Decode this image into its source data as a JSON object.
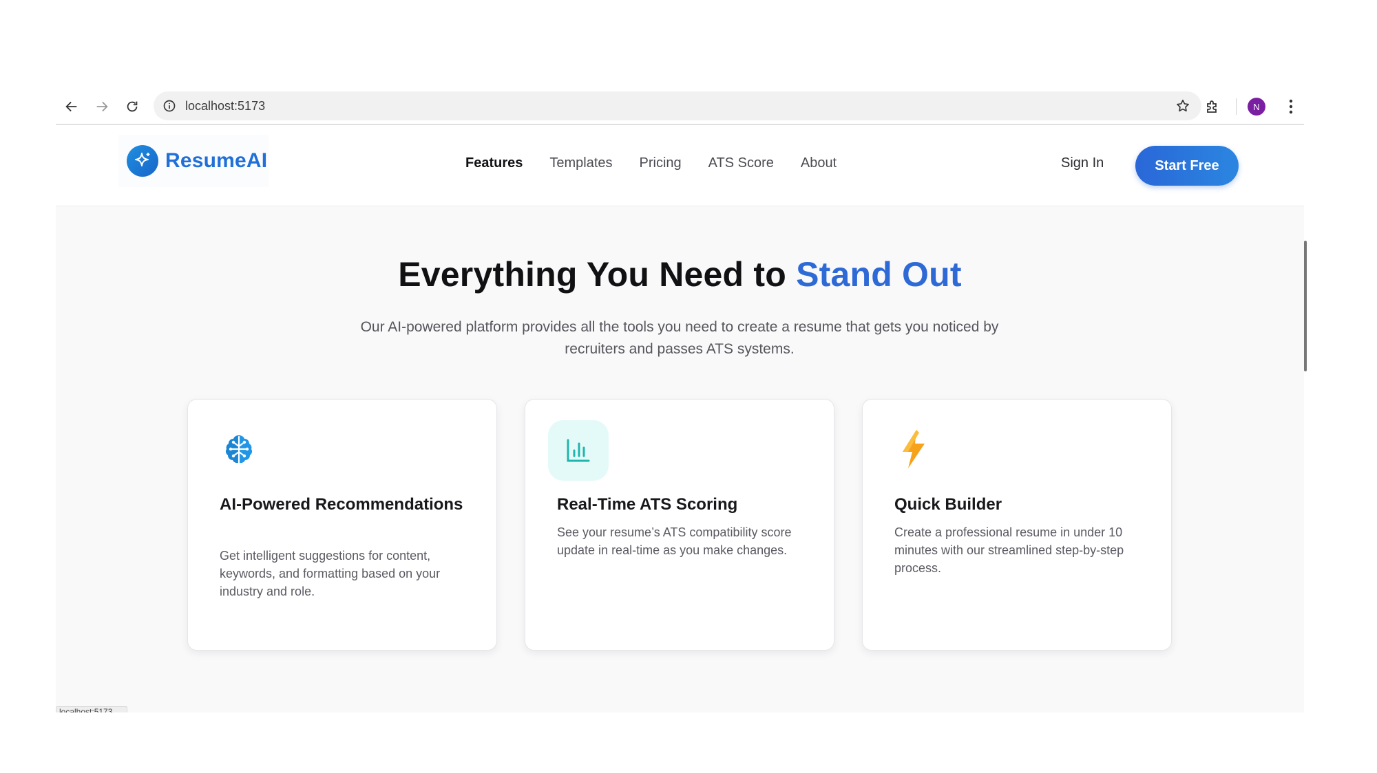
{
  "browser": {
    "url": "localhost:5173",
    "avatar_letter": "N",
    "avatar_color": "#7b1fa2"
  },
  "header": {
    "brand": "ResumeAI",
    "nav": [
      {
        "label": "Features",
        "active": true
      },
      {
        "label": "Templates",
        "active": false
      },
      {
        "label": "Pricing",
        "active": false
      },
      {
        "label": "ATS Score",
        "active": false
      },
      {
        "label": "About",
        "active": false
      }
    ],
    "sign_in": "Sign In",
    "cta": "Start Free"
  },
  "hero": {
    "title_main": "Everything You Need to ",
    "title_accent": "Stand Out",
    "subtitle": "Our AI-powered platform provides all the tools you need to create a resume that gets you noticed by recruiters and passes ATS systems."
  },
  "features": [
    {
      "icon": "brain-icon",
      "title": "AI-Powered Recommendations",
      "description": "Get intelligent suggestions for content, keywords, and formatting based on your industry and role."
    },
    {
      "icon": "bar-chart-icon",
      "title": "Real-Time ATS Scoring",
      "description": "See your resume’s ATS compatibility score update in real-time as you make changes."
    },
    {
      "icon": "lightning-icon",
      "title": "Quick Builder",
      "description": "Create a professional resume in under 10 minutes with our streamlined step-by-step process."
    }
  ],
  "status_bar": {
    "text": "localhost:5173"
  },
  "colors": {
    "accent": "#2e6ad6",
    "cta_gradient_start": "#2a67d8",
    "cta_gradient_end": "#2b86e0",
    "page_background": "#f9f9fa"
  }
}
